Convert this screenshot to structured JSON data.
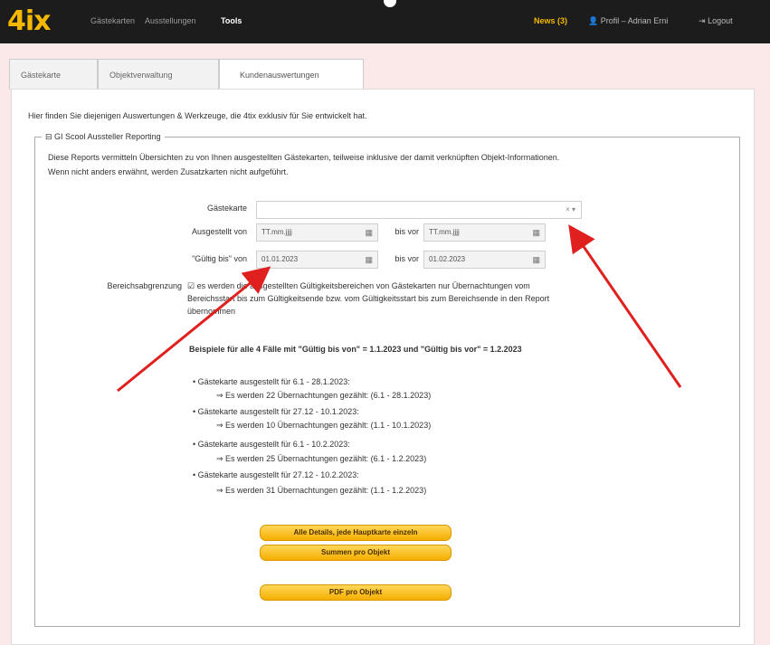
{
  "nav": {
    "logo": "4ix",
    "items": [
      "Gästekarten",
      "Ausstellungen",
      "Tools"
    ],
    "news": "News (3)",
    "profile": "Profil – Adrian Erni",
    "logout": "Logout"
  },
  "tabs": [
    "Gästekarte",
    "Objektverwaltung",
    "Kundenauswertungen"
  ],
  "intro": "Hier finden Sie diejenigen Auswertungen & Werkzeuge, die 4tix exklusiv für Sie entwickelt hat.",
  "section": {
    "legend": "⊟ GI Scool Aussteller Reporting",
    "desc1": "Diese Reports vermitteln Übersichten zu von Ihnen ausgestellten Gästekarten, teilweise inklusive der damit verknüpften Objekt-Informationen.",
    "desc2": "Wenn nicht anders erwähnt, werden Zusatzkarten nicht aufgeführt."
  },
  "form": {
    "gaestekarte_label": "Gästekarte",
    "gaestekarte_value": "",
    "ausgestellt_von_label": "Ausgestellt von",
    "ausgestellt_von_placeholder": "TT.mm.jjjj",
    "bis_vor_label": "bis vor",
    "bis_vor_placeholder": "TT.mm.jjjj",
    "gueltig_von_label": "\"Gültig bis\" von",
    "gueltig_von_value": "01.01.2023",
    "gueltig_bis_vor_label": "bis vor",
    "gueltig_bis_vor_value": "01.02.2023",
    "bereich_label": "Bereichsabgrenzung",
    "bereich_text_1": "☑ es werden die ausgestellten Gültigkeitsbereichen von Gästekarten nur Übernachtungen vom",
    "bereich_text_2": "Bereichsstart bis zum Gültigkeitsende bzw. vom Gültigkeitsstart bis zum Bereichsende in den Report",
    "bereich_text_3": "übernommen"
  },
  "examples": {
    "heading": "Beispiele für alle 4 Fälle mit \"Gültig bis von\" = 1.1.2023 und \"Gültig bis vor\" = 1.2.2023",
    "items": [
      {
        "title": "Gästekarte ausgestellt für 6.1 - 28.1.2023:",
        "result": "⇒ Es werden 22 Übernachtungen gezählt:  (6.1 - 28.1.2023)"
      },
      {
        "title": "Gästekarte ausgestellt für 27.12 - 10.1.2023:",
        "result": "⇒ Es werden 10 Übernachtungen gezählt:  (1.1 - 10.1.2023)"
      },
      {
        "title": "Gästekarte ausgestellt für 6.1 - 10.2.2023:",
        "result": "⇒ Es werden 25 Übernachtungen gezählt:  (6.1 - 1.2.2023)"
      },
      {
        "title": "Gästekarte ausgestellt für 27.12 - 10.2.2023:",
        "result": "⇒ Es werden 31 Übernachtungen gezählt:  (1.1 - 1.2.2023)"
      }
    ]
  },
  "buttons": {
    "details": "Alle Details, jede Hauptkarte einzeln",
    "summen": "Summen pro Objekt",
    "pdf": "PDF pro Objekt"
  },
  "colors": {
    "accent": "#f5b800",
    "arrow": "#e0201e",
    "topbar": "#1c1c1c"
  }
}
